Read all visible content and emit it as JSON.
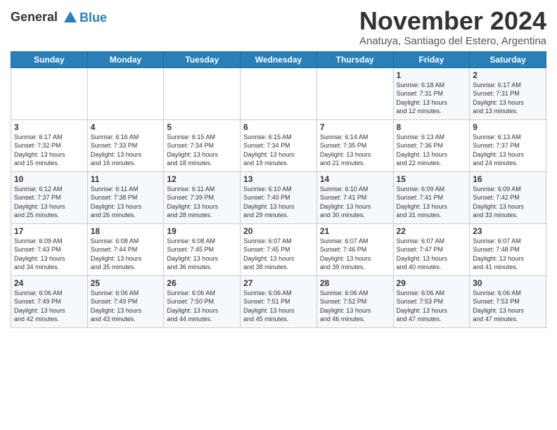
{
  "logo": {
    "line1": "General",
    "line2": "Blue"
  },
  "title": "November 2024",
  "location": "Anatuya, Santiago del Estero, Argentina",
  "weekdays": [
    "Sunday",
    "Monday",
    "Tuesday",
    "Wednesday",
    "Thursday",
    "Friday",
    "Saturday"
  ],
  "weeks": [
    [
      {
        "day": "",
        "info": ""
      },
      {
        "day": "",
        "info": ""
      },
      {
        "day": "",
        "info": ""
      },
      {
        "day": "",
        "info": ""
      },
      {
        "day": "",
        "info": ""
      },
      {
        "day": "1",
        "info": "Sunrise: 6:18 AM\nSunset: 7:31 PM\nDaylight: 13 hours\nand 12 minutes."
      },
      {
        "day": "2",
        "info": "Sunrise: 6:17 AM\nSunset: 7:31 PM\nDaylight: 13 hours\nand 13 minutes."
      }
    ],
    [
      {
        "day": "3",
        "info": "Sunrise: 6:17 AM\nSunset: 7:32 PM\nDaylight: 13 hours\nand 15 minutes."
      },
      {
        "day": "4",
        "info": "Sunrise: 6:16 AM\nSunset: 7:33 PM\nDaylight: 13 hours\nand 16 minutes."
      },
      {
        "day": "5",
        "info": "Sunrise: 6:15 AM\nSunset: 7:34 PM\nDaylight: 13 hours\nand 18 minutes."
      },
      {
        "day": "6",
        "info": "Sunrise: 6:15 AM\nSunset: 7:34 PM\nDaylight: 13 hours\nand 19 minutes."
      },
      {
        "day": "7",
        "info": "Sunrise: 6:14 AM\nSunset: 7:35 PM\nDaylight: 13 hours\nand 21 minutes."
      },
      {
        "day": "8",
        "info": "Sunrise: 6:13 AM\nSunset: 7:36 PM\nDaylight: 13 hours\nand 22 minutes."
      },
      {
        "day": "9",
        "info": "Sunrise: 6:13 AM\nSunset: 7:37 PM\nDaylight: 13 hours\nand 24 minutes."
      }
    ],
    [
      {
        "day": "10",
        "info": "Sunrise: 6:12 AM\nSunset: 7:37 PM\nDaylight: 13 hours\nand 25 minutes."
      },
      {
        "day": "11",
        "info": "Sunrise: 6:11 AM\nSunset: 7:38 PM\nDaylight: 13 hours\nand 26 minutes."
      },
      {
        "day": "12",
        "info": "Sunrise: 6:11 AM\nSunset: 7:39 PM\nDaylight: 13 hours\nand 28 minutes."
      },
      {
        "day": "13",
        "info": "Sunrise: 6:10 AM\nSunset: 7:40 PM\nDaylight: 13 hours\nand 29 minutes."
      },
      {
        "day": "14",
        "info": "Sunrise: 6:10 AM\nSunset: 7:41 PM\nDaylight: 13 hours\nand 30 minutes."
      },
      {
        "day": "15",
        "info": "Sunrise: 6:09 AM\nSunset: 7:41 PM\nDaylight: 13 hours\nand 31 minutes."
      },
      {
        "day": "16",
        "info": "Sunrise: 6:09 AM\nSunset: 7:42 PM\nDaylight: 13 hours\nand 33 minutes."
      }
    ],
    [
      {
        "day": "17",
        "info": "Sunrise: 6:09 AM\nSunset: 7:43 PM\nDaylight: 13 hours\nand 34 minutes."
      },
      {
        "day": "18",
        "info": "Sunrise: 6:08 AM\nSunset: 7:44 PM\nDaylight: 13 hours\nand 35 minutes."
      },
      {
        "day": "19",
        "info": "Sunrise: 6:08 AM\nSunset: 7:45 PM\nDaylight: 13 hours\nand 36 minutes."
      },
      {
        "day": "20",
        "info": "Sunrise: 6:07 AM\nSunset: 7:45 PM\nDaylight: 13 hours\nand 38 minutes."
      },
      {
        "day": "21",
        "info": "Sunrise: 6:07 AM\nSunset: 7:46 PM\nDaylight: 13 hours\nand 39 minutes."
      },
      {
        "day": "22",
        "info": "Sunrise: 6:07 AM\nSunset: 7:47 PM\nDaylight: 13 hours\nand 40 minutes."
      },
      {
        "day": "23",
        "info": "Sunrise: 6:07 AM\nSunset: 7:48 PM\nDaylight: 13 hours\nand 41 minutes."
      }
    ],
    [
      {
        "day": "24",
        "info": "Sunrise: 6:06 AM\nSunset: 7:49 PM\nDaylight: 13 hours\nand 42 minutes."
      },
      {
        "day": "25",
        "info": "Sunrise: 6:06 AM\nSunset: 7:49 PM\nDaylight: 13 hours\nand 43 minutes."
      },
      {
        "day": "26",
        "info": "Sunrise: 6:06 AM\nSunset: 7:50 PM\nDaylight: 13 hours\nand 44 minutes."
      },
      {
        "day": "27",
        "info": "Sunrise: 6:06 AM\nSunset: 7:51 PM\nDaylight: 13 hours\nand 45 minutes."
      },
      {
        "day": "28",
        "info": "Sunrise: 6:06 AM\nSunset: 7:52 PM\nDaylight: 13 hours\nand 46 minutes."
      },
      {
        "day": "29",
        "info": "Sunrise: 6:06 AM\nSunset: 7:53 PM\nDaylight: 13 hours\nand 47 minutes."
      },
      {
        "day": "30",
        "info": "Sunrise: 6:06 AM\nSunset: 7:53 PM\nDaylight: 13 hours\nand 47 minutes."
      }
    ]
  ]
}
